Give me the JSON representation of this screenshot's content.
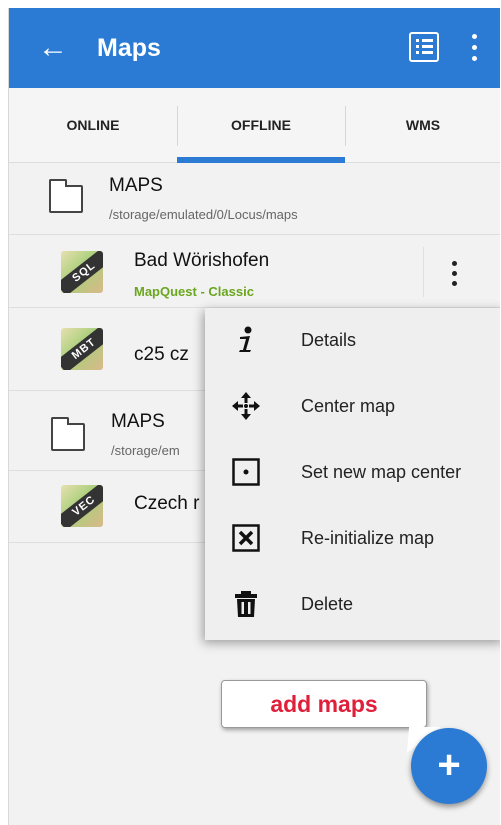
{
  "appbar": {
    "title": "Maps"
  },
  "tabs": [
    {
      "label": "ONLINE"
    },
    {
      "label": "OFFLINE",
      "selected": true
    },
    {
      "label": "WMS"
    }
  ],
  "folders": [
    {
      "title": "MAPS",
      "path": "/storage/emulated/0/Locus/maps"
    },
    {
      "title": "MAPS",
      "path": "/storage/em"
    }
  ],
  "maps": [
    {
      "name": "Bad Wörishofen",
      "subtitle": "MapQuest - Classic",
      "badge": "SQL"
    },
    {
      "name": "c25 cz",
      "badge": "MBT"
    },
    {
      "name": "Czech r",
      "badge": "VEC"
    }
  ],
  "menu": [
    {
      "label": "Details",
      "icon": "info-icon"
    },
    {
      "label": "Center map",
      "icon": "move-arrows-icon"
    },
    {
      "label": "Set new map center",
      "icon": "center-dot-icon"
    },
    {
      "label": "Re-initialize map",
      "icon": "x-box-icon"
    },
    {
      "label": "Delete",
      "icon": "trash-icon"
    }
  ],
  "callout": {
    "text": "add maps"
  },
  "fab": {
    "label": "+"
  },
  "colors": {
    "primary": "#2b7bd4",
    "subtitle_green": "#6aa61e",
    "callout_red": "#e0203a"
  }
}
